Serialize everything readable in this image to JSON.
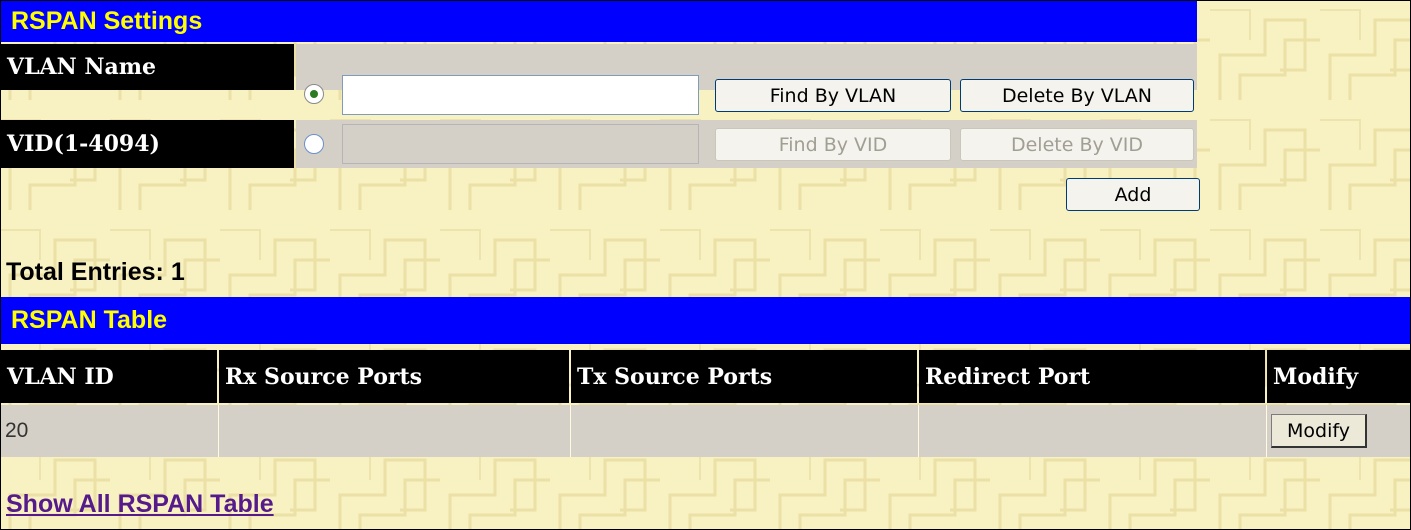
{
  "rspan_settings": {
    "title": "RSPAN Settings",
    "vlan_name_row": {
      "label": "VLAN Name",
      "radio_selected": true,
      "input_value": "",
      "find_button": "Find By VLAN",
      "delete_button": "Delete By VLAN"
    },
    "vid_row": {
      "label": "VID(1-4094)",
      "radio_selected": false,
      "input_value": "",
      "find_button": "Find By VID",
      "delete_button": "Delete By VID"
    },
    "add_button": "Add"
  },
  "total_entries": "Total Entries: 1",
  "rspan_table": {
    "title": "RSPAN Table",
    "columns": [
      "VLAN ID",
      "Rx Source Ports",
      "Tx Source Ports",
      "Redirect Port",
      "Modify"
    ],
    "rows": [
      {
        "vlan_id": "20",
        "rx_source_ports": "",
        "tx_source_ports": "",
        "redirect_port": "",
        "modify_button": "Modify"
      }
    ]
  },
  "show_all_link": "Show All RSPAN Table",
  "colors": {
    "page_background": "#f8f1c2",
    "header_blue": "#0000fe",
    "header_text": "#ffff00",
    "label_background": "#000000",
    "row_gray": "#d4d0c8",
    "link": "#551a8b"
  }
}
